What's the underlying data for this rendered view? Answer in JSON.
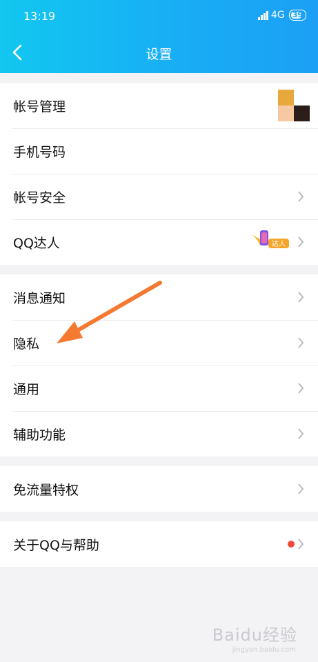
{
  "status_bar": {
    "time": "13:19",
    "network": "4G",
    "battery": "39"
  },
  "header": {
    "title": "设置"
  },
  "groups": [
    {
      "items": [
        {
          "label": "帐号管理"
        },
        {
          "label": "手机号码"
        },
        {
          "label": "帐号安全"
        },
        {
          "label": "QQ达人",
          "badge": "达人"
        }
      ]
    },
    {
      "items": [
        {
          "label": "消息通知"
        },
        {
          "label": "隐私"
        },
        {
          "label": "通用"
        },
        {
          "label": "辅助功能"
        }
      ]
    },
    {
      "items": [
        {
          "label": "免流量特权"
        }
      ]
    },
    {
      "items": [
        {
          "label": "关于QQ与帮助"
        }
      ]
    }
  ],
  "watermark": {
    "text": "Baidu经验",
    "sub": "jingyan.baidu.com"
  },
  "colors": {
    "header_start": "#12c7f0",
    "header_end": "#1c9ff5",
    "annotation_arrow": "#f47a32",
    "red_dot": "#f24a3b"
  }
}
